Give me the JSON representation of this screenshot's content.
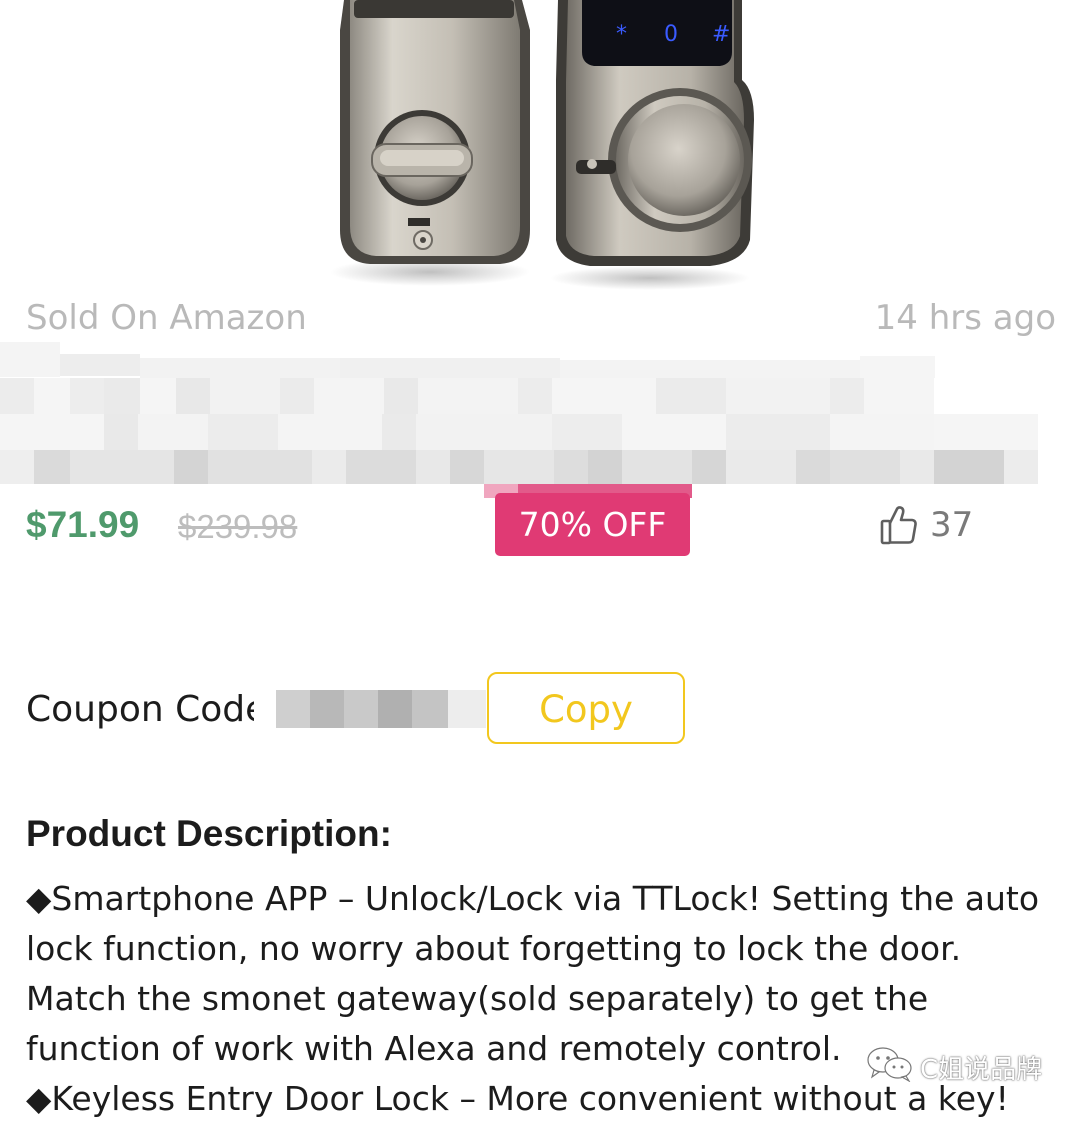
{
  "product": {
    "source": "Sold On Amazon",
    "posted": "14 hrs ago",
    "price": "$71.99",
    "original_price": "$239.98",
    "discount": "70% OFF",
    "likes": "37"
  },
  "coupon": {
    "label": "Coupon Code",
    "copy_label": "Copy"
  },
  "description": {
    "heading": "Product Description:",
    "bullet": "◆",
    "items": [
      "Smartphone APP – Unlock/Lock via TTLock! Setting the auto lock function, no worry about forgetting to lock the door. Match the smonet gateway(sold separately) to get the function of work with Alexa and remotely control.",
      "Keyless Entry Door Lock – More convenient without a key!"
    ]
  },
  "watermark": {
    "text": "C姐说品牌"
  },
  "keypad": {
    "keys": [
      "*",
      "0",
      "#"
    ]
  },
  "colors": {
    "price_green": "#4f9a6c",
    "badge_pink": "#e03a74",
    "copy_yellow": "#f2c71e",
    "muted_gray": "#b9b9b9"
  },
  "icons": {
    "like": "thumbs-up-icon",
    "watermark": "wechat-icon"
  }
}
